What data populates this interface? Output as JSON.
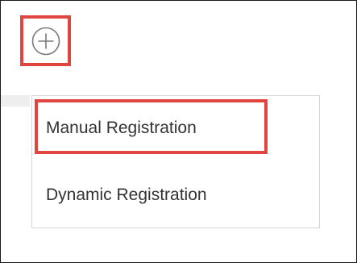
{
  "add_button": {
    "icon": "plus-circle-icon",
    "highlight_color": "#e0453f"
  },
  "menu": {
    "items": [
      {
        "label": "Manual Registration"
      },
      {
        "label": "Dynamic Registration"
      }
    ]
  },
  "colors": {
    "highlight": "#e0453f",
    "text": "#333333",
    "menu_border": "#d5d5d5"
  }
}
